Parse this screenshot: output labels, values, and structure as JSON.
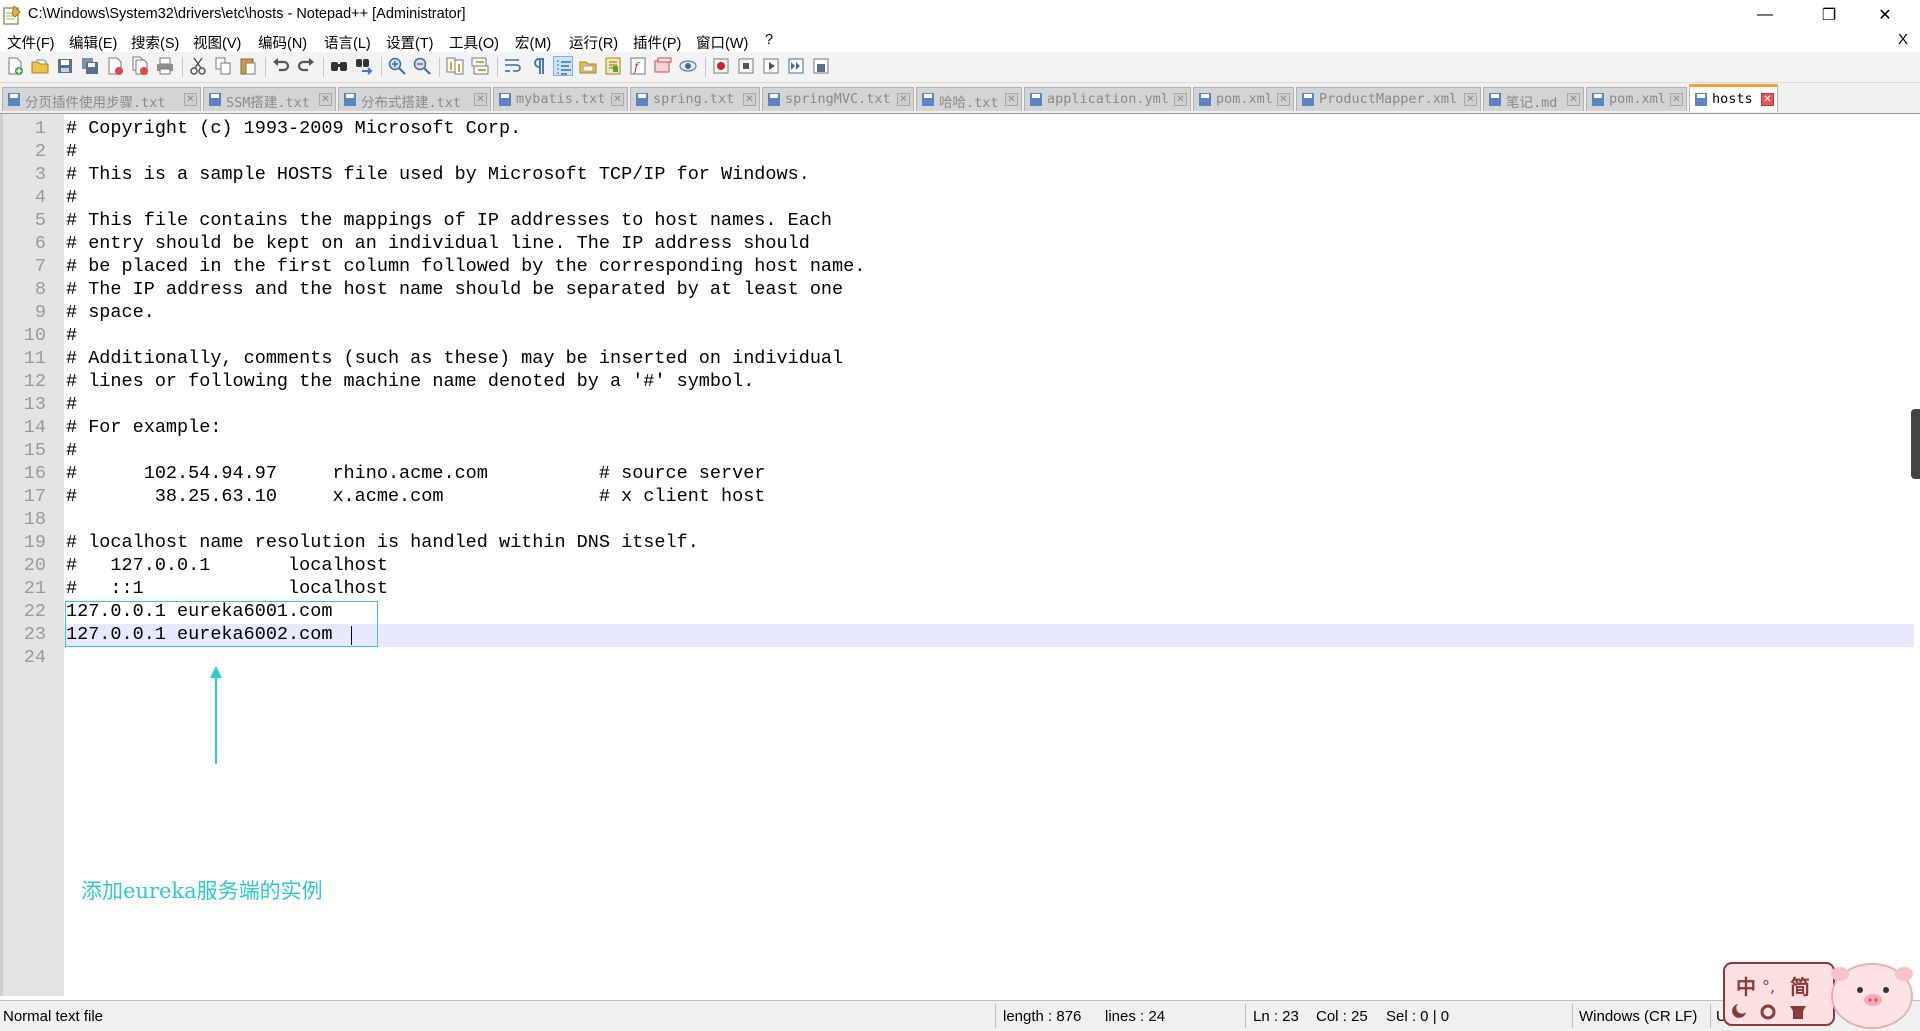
{
  "window": {
    "title": "C:\\Windows\\System32\\drivers\\etc\\hosts - Notepad++ [Administrator]",
    "buttons": {
      "minimize": "—",
      "restore": "❐",
      "close": "✕"
    }
  },
  "menu": {
    "items": [
      "文件(F)",
      "编辑(E)",
      "搜索(S)",
      "视图(V)",
      "编码(N)",
      "语言(L)",
      "设置(T)",
      "工具(O)",
      "宏(M)",
      "运行(R)",
      "插件(P)",
      "窗口(W)",
      "?"
    ],
    "close_label": "X"
  },
  "toolbar": {
    "icons": [
      "new-file-icon",
      "open-file-icon",
      "save-icon",
      "save-all-icon",
      "close-icon",
      "close-all-icon",
      "print-icon",
      "cut-icon",
      "copy-icon",
      "paste-icon",
      "undo-icon",
      "redo-icon",
      "find-icon",
      "replace-icon",
      "zoom-in-icon",
      "zoom-out-icon",
      "sync-vertical-icon",
      "sync-horizontal-icon",
      "word-wrap-icon",
      "show-all-chars-icon",
      "indent-guide-icon",
      "folder-as-workspace-icon",
      "document-map-icon",
      "function-list-icon",
      "doc-switcher-icon",
      "monitoring-icon",
      "record-macro-icon",
      "stop-record-icon",
      "play-macro-icon",
      "run-macro-multiple-icon",
      "save-macro-icon"
    ]
  },
  "tabs": [
    {
      "label": "分页插件使用步骤.txt",
      "active": false
    },
    {
      "label": "SSM搭建.txt",
      "active": false
    },
    {
      "label": "分布式搭建.txt",
      "active": false
    },
    {
      "label": "mybatis.txt",
      "active": false
    },
    {
      "label": "spring.txt",
      "active": false
    },
    {
      "label": "springMVC.txt",
      "active": false
    },
    {
      "label": "哈哈.txt",
      "active": false
    },
    {
      "label": "application.yml",
      "active": false
    },
    {
      "label": "pom.xml",
      "active": false
    },
    {
      "label": "ProductMapper.xml",
      "active": false
    },
    {
      "label": "笔记.md",
      "active": false
    },
    {
      "label": "pom.xml",
      "active": false
    },
    {
      "label": "hosts",
      "active": true
    }
  ],
  "editor": {
    "line_numbers": [
      "1",
      "2",
      "3",
      "4",
      "5",
      "6",
      "7",
      "8",
      "9",
      "10",
      "11",
      "12",
      "13",
      "14",
      "15",
      "16",
      "17",
      "18",
      "19",
      "20",
      "21",
      "22",
      "23",
      "24"
    ],
    "lines": [
      "# Copyright (c) 1993-2009 Microsoft Corp.",
      "#",
      "# This is a sample HOSTS file used by Microsoft TCP/IP for Windows.",
      "#",
      "# This file contains the mappings of IP addresses to host names. Each",
      "# entry should be kept on an individual line. The IP address should",
      "# be placed in the first column followed by the corresponding host name.",
      "# The IP address and the host name should be separated by at least one",
      "# space.",
      "#",
      "# Additionally, comments (such as these) may be inserted on individual",
      "# lines or following the machine name denoted by a '#' symbol.",
      "#",
      "# For example:",
      "#",
      "#      102.54.94.97     rhino.acme.com          # source server",
      "#       38.25.63.10     x.acme.com              # x client host",
      "",
      "# localhost name resolution is handled within DNS itself.",
      "#   127.0.0.1       localhost",
      "#   ::1             localhost",
      "127.0.0.1 eureka6001.com",
      "127.0.0.1 eureka6002.com",
      ""
    ],
    "current_line": 23
  },
  "annotation": {
    "text": "添加eureka服务端的实例",
    "color": "#2ccaca"
  },
  "status": {
    "file_type": "Normal text file",
    "length": "length : 876",
    "lines": "lines : 24",
    "ln": "Ln : 23",
    "col": "Col : 25",
    "sel": "Sel : 0 | 0",
    "eol": "Windows (CR LF)",
    "encoding_partial": "U"
  },
  "ime": {
    "label": "中",
    "mode": "°,",
    "script": "简"
  },
  "colors": {
    "tab_active_accent": "#f2a23c",
    "close_red": "#e05757",
    "current_line": "#e8e8ff",
    "selection_border": "#39c8c8"
  }
}
